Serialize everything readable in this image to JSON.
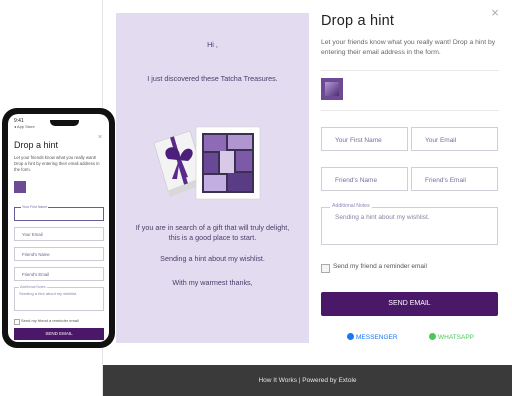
{
  "email_preview": {
    "greeting": "Hi ,",
    "line1": "I just discovered these Tatcha Treasures.",
    "line2a": "If you are in search of a gift that will truly delight,",
    "line2b": "this is a good place to start.",
    "line3": "Sending a hint about my wishlist.",
    "signoff": "With my warmest thanks,"
  },
  "modal": {
    "title": "Drop a hint",
    "subtitle": "Let your friends know what you really want! Drop a hint by entering their email address in the form.",
    "close_glyph": "×",
    "fields": {
      "your_first_name": "Your First Name",
      "your_email": "Your Email",
      "friends_name": "Friend's Name",
      "friends_email": "Friend's Email"
    },
    "notes_label": "Additional Notes",
    "notes_placeholder": "Sending a hint about my wishlist.",
    "reminder_label": "Send my friend a reminder email",
    "send_label": "SEND EMAIL",
    "share": {
      "messenger": "MESSENGER",
      "whatsapp": "WHATSAPP"
    },
    "footer": "How It Works  |  Powered by Extole"
  },
  "phone": {
    "time": "9:41",
    "back": "◂ App Store",
    "title": "Drop a hint",
    "subtitle": "Let your friends know what you really want! Drop a hint by entering their email address in the form.",
    "first_name_label": "Your First Name",
    "your_email": "Your Email",
    "friends_name": "Friend's Name",
    "friends_email": "Friend's Email",
    "notes_label": "Additional Notes",
    "notes_placeholder": "Sending a hint about my wishlist.",
    "reminder_label": "Send my friend a reminder email",
    "send_label": "SEND EMAIL"
  },
  "colors": {
    "brand_purple": "#4b1768",
    "preview_bg": "#e3dbef",
    "messenger_blue": "#1877f2",
    "whatsapp_green": "#4ac959"
  }
}
